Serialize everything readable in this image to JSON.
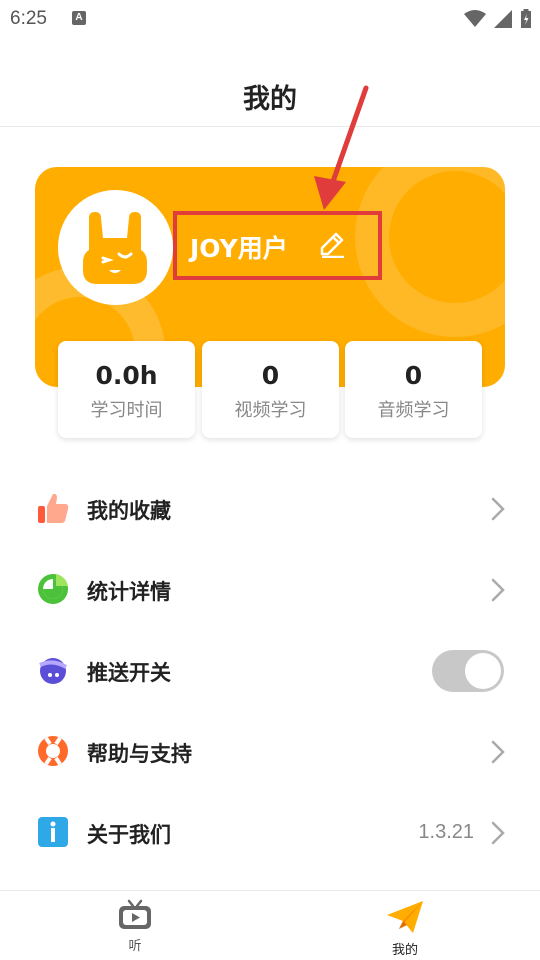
{
  "status_bar": {
    "time": "6:25",
    "notification_letter": "A"
  },
  "header": {
    "title": "我的"
  },
  "profile": {
    "username": "JOY用户",
    "avatar_icon": "bunny-avatar-icon",
    "edit_icon": "pencil-icon",
    "accent_color": "#ffad00",
    "annotation_color": "#e03c3c"
  },
  "stats": [
    {
      "value": "0.0h",
      "label": "学习时间"
    },
    {
      "value": "0",
      "label": "视频学习"
    },
    {
      "value": "0",
      "label": "音频学习"
    }
  ],
  "menu": [
    {
      "label": "我的收藏",
      "icon": "thumbs-up-icon"
    },
    {
      "label": "统计详情",
      "icon": "pie-chart-icon"
    },
    {
      "label": "推送开关",
      "icon": "planet-icon",
      "toggle_on": true
    },
    {
      "label": "帮助与支持",
      "icon": "lifebuoy-icon"
    },
    {
      "label": "关于我们",
      "icon": "info-icon",
      "value": "1.3.21"
    }
  ],
  "bottom_nav": [
    {
      "label": "听",
      "icon": "tv-icon",
      "active": false
    },
    {
      "label": "我的",
      "icon": "paper-plane-icon",
      "active": true
    }
  ]
}
